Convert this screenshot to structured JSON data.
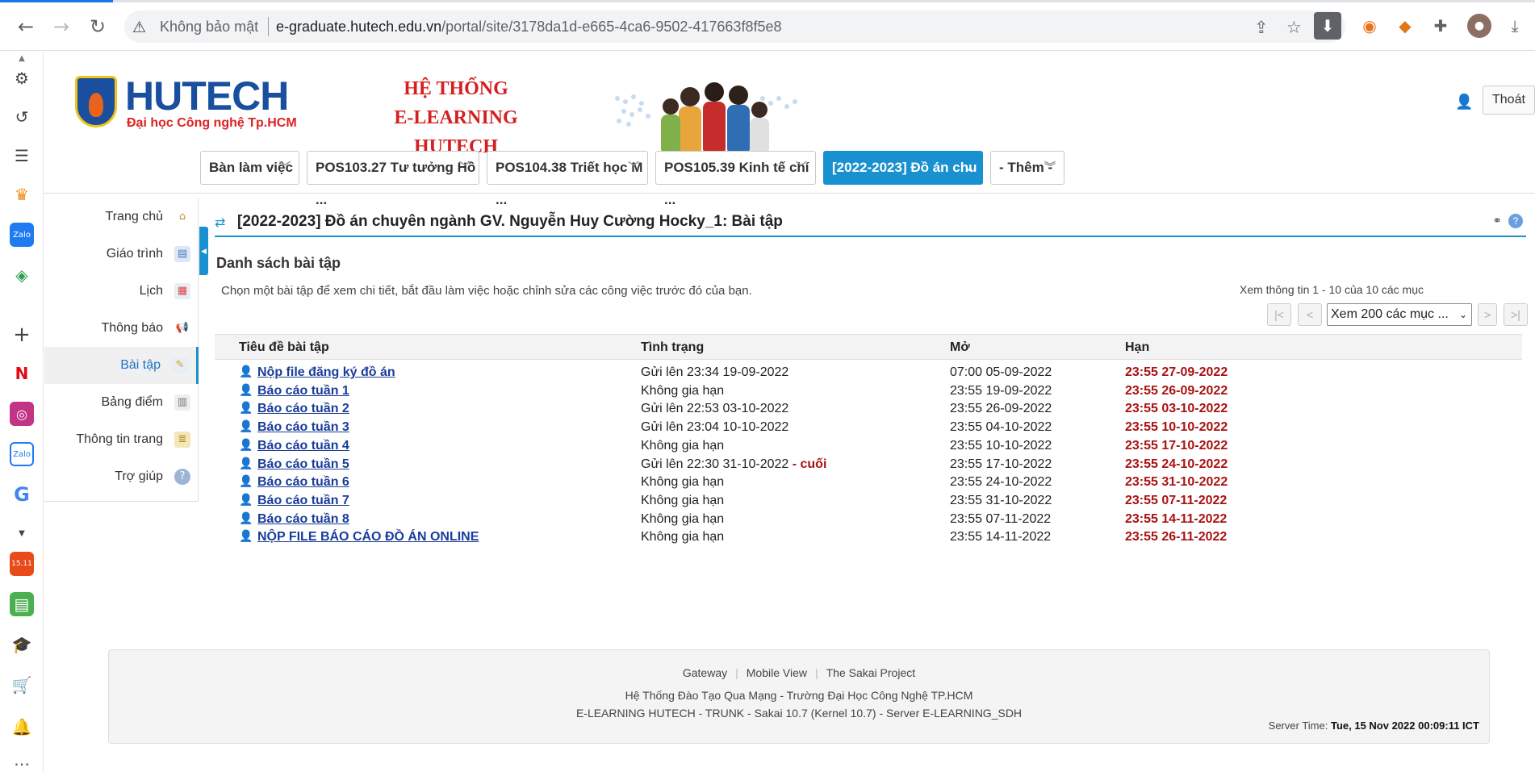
{
  "browser": {
    "security_label": "Không bảo mật",
    "url_host": "e-graduate.hutech.edu.vn",
    "url_path": "/portal/site/3178da1d-e665-4ca6-9502-417663f8f5e8"
  },
  "header": {
    "logo_brand": "HUTECH",
    "logo_sub": "Đại học Công nghệ Tp.HCM",
    "banner_line1": "HỆ THỐNG",
    "banner_line2": "E-LEARNING HUTECH",
    "logout_label": "Thoát"
  },
  "site_tabs": [
    {
      "label": "Bàn làm việc"
    },
    {
      "label": "POS103.27 Tư tưởng Hồ ..."
    },
    {
      "label": "POS104.38 Triết học M ..."
    },
    {
      "label": "POS105.39 Kinh tế chí ..."
    },
    {
      "label": "[2022-2023] Đồ án chu ..."
    },
    {
      "label": "- Thêm -"
    }
  ],
  "tool_menu": [
    {
      "label": "Trang chủ"
    },
    {
      "label": "Giáo trình"
    },
    {
      "label": "Lịch"
    },
    {
      "label": "Thông báo"
    },
    {
      "label": "Bài tập"
    },
    {
      "label": "Bảng điểm"
    },
    {
      "label": "Thông tin trang"
    },
    {
      "label": "Trợ giúp"
    }
  ],
  "content": {
    "title": "[2022-2023] Đồ án chuyên ngành GV. Nguyễn Huy Cường Hocky_1: Bài tập",
    "list_heading": "Danh sách bài tập",
    "instructions": "Chọn một bài tập để xem chi tiết, bắt đầu làm việc hoặc chỉnh sửa các công việc trước đó của bạn.",
    "page_info": "Xem thông tin 1 - 10 của 10 các mục",
    "page_size": "Xem 200 các mục ...",
    "pager": {
      "first": "|<",
      "prev": "<",
      "next": ">",
      "last": ">|"
    }
  },
  "table": {
    "headers": {
      "title": "Tiêu đề bài tập",
      "status": "Tình trạng",
      "open": "Mở",
      "due": "Hạn"
    },
    "rows": [
      {
        "title": "Nộp file đăng ký đồ án",
        "status": "Gửi lên 23:34 19-09-2022",
        "late": "",
        "open": "07:00 05-09-2022",
        "due": "23:55 27-09-2022"
      },
      {
        "title": "Báo cáo tuần 1",
        "status": "Không gia hạn",
        "late": "",
        "open": "23:55 19-09-2022",
        "due": "23:55 26-09-2022"
      },
      {
        "title": "Báo cáo tuần 2",
        "status": "Gửi lên 22:53 03-10-2022",
        "late": "",
        "open": "23:55 26-09-2022",
        "due": "23:55 03-10-2022"
      },
      {
        "title": "Báo cáo tuần 3",
        "status": "Gửi lên 23:04 10-10-2022",
        "late": "",
        "open": "23:55 04-10-2022",
        "due": "23:55 10-10-2022"
      },
      {
        "title": "Báo cáo tuần 4",
        "status": "Không gia hạn",
        "late": "",
        "open": "23:55 10-10-2022",
        "due": "23:55 17-10-2022"
      },
      {
        "title": "Báo cáo tuần 5",
        "status": "Gửi lên 22:30 31-10-2022",
        "late": "- cuối",
        "open": "23:55 17-10-2022",
        "due": "23:55 24-10-2022"
      },
      {
        "title": "Báo cáo tuần 6",
        "status": "Không gia hạn",
        "late": "",
        "open": "23:55 24-10-2022",
        "due": "23:55 31-10-2022"
      },
      {
        "title": "Báo cáo tuần 7",
        "status": "Không gia hạn",
        "late": "",
        "open": "23:55 31-10-2022",
        "due": "23:55 07-11-2022"
      },
      {
        "title": "Báo cáo tuần 8",
        "status": "Không gia hạn",
        "late": "",
        "open": "23:55 07-11-2022",
        "due": "23:55 14-11-2022"
      },
      {
        "title": "NỘP FILE BÁO CÁO ĐỒ ÁN ONLINE",
        "status": "Không gia hạn",
        "late": "",
        "open": "23:55 14-11-2022",
        "due": "23:55 26-11-2022"
      }
    ]
  },
  "footer": {
    "links": [
      "Gateway",
      "Mobile View",
      "The Sakai Project"
    ],
    "line1": "Hệ Thống Đào Tạo Qua Mạng - Trường Đại Học Công Nghệ TP.HCM",
    "line2": "E-LEARNING HUTECH - TRUNK - Sakai 10.7 (Kernel 10.7) - Server E-LEARNING_SDH",
    "server_label": "Server Time:",
    "server_time": "Tue, 15 Nov 2022 00:09:11 ICT"
  },
  "colors": {
    "accent": "#1990cf",
    "due_red": "#aa1111",
    "link_blue": "#1a3d9a"
  }
}
